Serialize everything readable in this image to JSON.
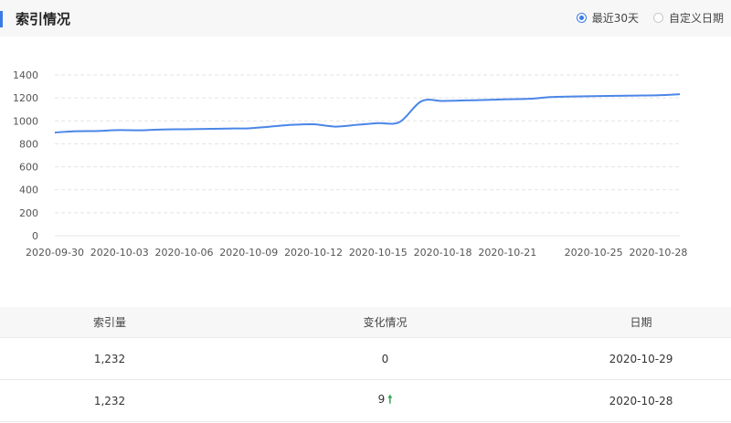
{
  "header": {
    "title": "索引情况",
    "options": [
      {
        "label": "最近30天",
        "checked": true
      },
      {
        "label": "自定义日期",
        "checked": false
      }
    ],
    "accent_color": "#3a7be8"
  },
  "chart_data": {
    "type": "line",
    "title": "",
    "xlabel": "",
    "ylabel": "",
    "ylim": [
      0,
      1400
    ],
    "yticks": [
      0,
      200,
      400,
      600,
      800,
      1000,
      1200,
      1400
    ],
    "xticks": [
      "2020-09-30",
      "2020-10-03",
      "2020-10-06",
      "2020-10-09",
      "2020-10-12",
      "2020-10-15",
      "2020-10-18",
      "2020-10-21",
      "2020-10-25",
      "2020-10-28"
    ],
    "grid": true,
    "line_color": "#4a86e8",
    "x": [
      "2020-09-30",
      "2020-10-01",
      "2020-10-02",
      "2020-10-03",
      "2020-10-04",
      "2020-10-05",
      "2020-10-06",
      "2020-10-07",
      "2020-10-08",
      "2020-10-09",
      "2020-10-10",
      "2020-10-11",
      "2020-10-12",
      "2020-10-13",
      "2020-10-14",
      "2020-10-15",
      "2020-10-16",
      "2020-10-17",
      "2020-10-18",
      "2020-10-19",
      "2020-10-20",
      "2020-10-21",
      "2020-10-22",
      "2020-10-23",
      "2020-10-24",
      "2020-10-25",
      "2020-10-26",
      "2020-10-27",
      "2020-10-28",
      "2020-10-29"
    ],
    "values": [
      899,
      910,
      912,
      920,
      918,
      925,
      927,
      930,
      933,
      935,
      950,
      965,
      970,
      950,
      965,
      980,
      990,
      1170,
      1173,
      1178,
      1182,
      1188,
      1192,
      1207,
      1212,
      1215,
      1218,
      1220,
      1223,
      1232
    ]
  },
  "table": {
    "headers": [
      "索引量",
      "变化情况",
      "日期"
    ],
    "rows": [
      {
        "count": "1,232",
        "change": "0",
        "trend": "",
        "date": "2020-10-29"
      },
      {
        "count": "1,232",
        "change": "9",
        "trend": "up",
        "date": "2020-10-28"
      }
    ],
    "up_color": "#2fa54b"
  }
}
